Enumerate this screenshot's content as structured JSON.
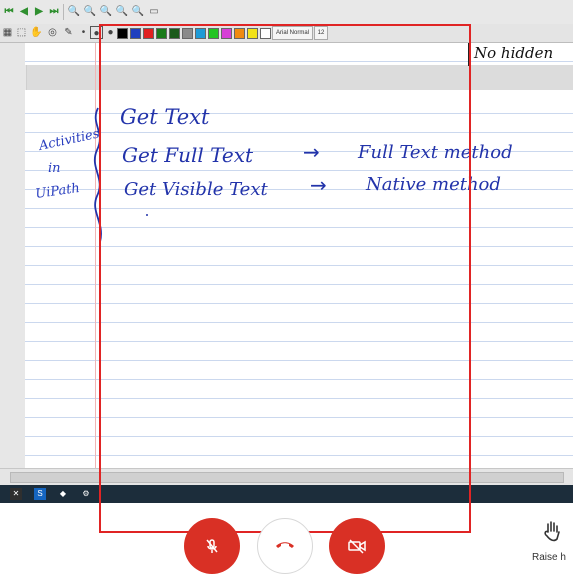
{
  "toolbar": {
    "font_name": "Arial Normal",
    "font_size": "12",
    "palette": [
      "#1f3fbf",
      "#e02020",
      "#1a7a1a",
      "#1a5a1a",
      "#8a8a8a",
      "#1e9ad6",
      "#22c422",
      "#d63fd6",
      "#f08a10",
      "#f2e21a",
      "#ffffff",
      "#2a3fd6"
    ]
  },
  "notes": {
    "top_fragment": "No hidden",
    "side_label": [
      "Activities",
      "in",
      "UiPath"
    ],
    "line1": "Get Text",
    "line2_left": "Get Full Text",
    "line2_right": "Full Text method",
    "line3_left": "Get Visible Text",
    "line3_right": "Native method",
    "arrow": "→"
  },
  "meeting_controls": {
    "raise_hand_label": "Raise h"
  },
  "colors": {
    "ink": "#2233aa",
    "share_border": "#e02424",
    "call_red": "#d93025"
  }
}
